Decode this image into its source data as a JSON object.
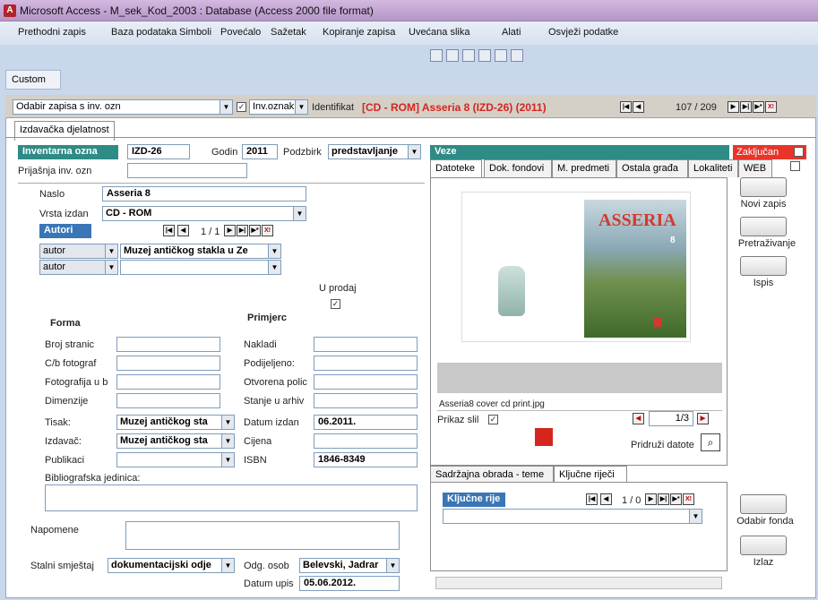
{
  "window": {
    "title": "Microsoft Access - M_sek_Kod_2003 : Database (Access 2000 file format)"
  },
  "menu": {
    "items": [
      "Prethodni zapis",
      "Baza podataka",
      "Simboli",
      "Povećalo",
      "Sažetak",
      "Kopiranje zapisa",
      "Uvećana slika",
      "Alati",
      "Osvježi podatke"
    ]
  },
  "ribbon": {
    "custom_label": "Custom"
  },
  "topbar": {
    "select_label": "Odabir zapisa s inv. ozn",
    "inv_label": "Inv.oznak",
    "ident_label": "Identifikat",
    "ident_value": "[CD - ROM] Asseria 8 (IZD-26) (2011)",
    "record_pos": "107 / 209"
  },
  "tabs": {
    "main": "Izdavačka djelatnost"
  },
  "left": {
    "inv_label": "Inventarna ozna",
    "inv_value": "IZD-26",
    "godina_label": "Godin",
    "godina_value": "2011",
    "podzbirka_label": "Podzbirk",
    "podzbirka_value": "predstavljanje",
    "prijasnja_label": "Prijašnja inv. ozn",
    "naslov_label": "Naslo",
    "naslov_value": "Asseria 8",
    "vrsta_label": "Vrsta izdan",
    "vrsta_value": "CD - ROM",
    "autori_label": "Autori",
    "autori_pos": "1 / 1",
    "autor_rows": [
      {
        "role": "autor",
        "name": "Muzej antičkog stakla u Ze"
      },
      {
        "role": "autor",
        "name": ""
      }
    ],
    "uprodaji_label": "U prodaj",
    "forma_label": "Forma",
    "primjerci_label": "Primjerc",
    "forma_fields": [
      "Broj stranic",
      "C/b fotograf",
      "Fotografija u b",
      "Dimenzije"
    ],
    "primjerci_fields": [
      "Nakladi",
      "Podijeljeno:",
      "Otvorena polic",
      "Stanje u arhiv"
    ],
    "tisak_label": "Tisak:",
    "tisak_value": "Muzej antičkog sta",
    "izdavac_label": "Izdavač:",
    "izdavac_value": "Muzej antičkog sta",
    "publikaci_label": "Publikaci",
    "datum_label": "Datum izdan",
    "datum_value": "06.2011.",
    "cijena_label": "Cijena",
    "isbn_label": "ISBN",
    "isbn_value": "1846-8349",
    "biblio_label": "Bibliografska jedinica:",
    "napomene_label": "Napomene",
    "stalni_label": "Stalni smještaj",
    "stalni_value": "dokumentacijski odje",
    "odg_label": "Odg. osob",
    "odg_value": "Belevski, Jadrar",
    "datum_upis_label": "Datum upis",
    "datum_upis_value": "05.06.2012."
  },
  "right": {
    "veze_label": "Veze",
    "zakljucan_label": "Zaključan",
    "tabs": [
      "Datoteke",
      "Dok. fondovi",
      "M. predmeti",
      "Ostala građa",
      "Lokaliteti",
      "WEB"
    ],
    "cover_title": "ASSERIA",
    "cover_number": "8",
    "file_name": "Asseria8 cover cd print.jpg",
    "prikaz_label": "Prikaz slil",
    "image_pos": "1/3",
    "pridruzi_label": "Pridruži datote",
    "bottom_tabs": [
      "Sadržajna obrada - teme",
      "Ključne riječi"
    ],
    "kljucne_label": "Ključne rije",
    "kljucne_pos": "1 / 0"
  },
  "sidebar": {
    "novi_zapis": "Novi zapis",
    "pretrazivanje": "Pretraživanje",
    "ispis": "Ispis",
    "odabir_fonda": "Odabir fonda",
    "izlaz": "Izlaz"
  }
}
